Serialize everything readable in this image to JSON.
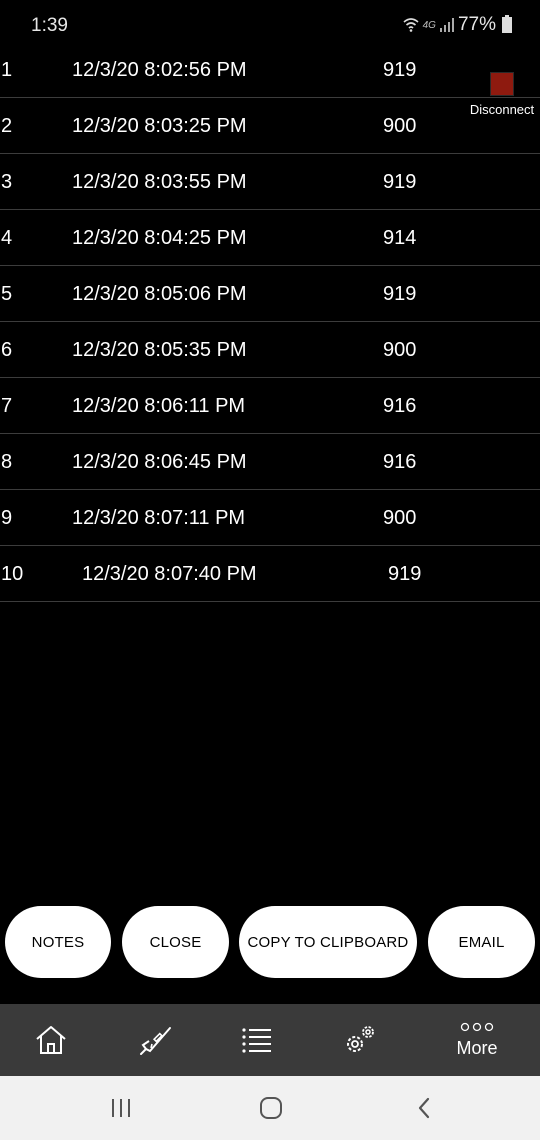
{
  "status_bar": {
    "time": "1:39",
    "network": "4G",
    "battery": "77%"
  },
  "readings": [
    {
      "index": "1",
      "timestamp": "12/3/20 8:02:56 PM",
      "value": "919"
    },
    {
      "index": "2",
      "timestamp": "12/3/20 8:03:25 PM",
      "value": "900"
    },
    {
      "index": "3",
      "timestamp": "12/3/20 8:03:55 PM",
      "value": "919"
    },
    {
      "index": "4",
      "timestamp": "12/3/20 8:04:25 PM",
      "value": "914"
    },
    {
      "index": "5",
      "timestamp": "12/3/20 8:05:06 PM",
      "value": "919"
    },
    {
      "index": "6",
      "timestamp": "12/3/20 8:05:35 PM",
      "value": "900"
    },
    {
      "index": "7",
      "timestamp": "12/3/20 8:06:11 PM",
      "value": "916"
    },
    {
      "index": "8",
      "timestamp": "12/3/20 8:06:45 PM",
      "value": "916"
    },
    {
      "index": "9",
      "timestamp": "12/3/20 8:07:11 PM",
      "value": "900"
    },
    {
      "index": "10",
      "timestamp": "12/3/20 8:07:40 PM",
      "value": "919"
    }
  ],
  "disconnect": {
    "label": "Disconnect",
    "color": "#8e1a0f"
  },
  "actions": {
    "notes": "NOTES",
    "close": "CLOSE",
    "copy": "COPY TO CLIPBOARD",
    "email": "EMAIL"
  },
  "tabbar": {
    "tabs": [
      {
        "icon": "home-icon"
      },
      {
        "icon": "rifle-icon"
      },
      {
        "icon": "list-icon"
      },
      {
        "icon": "settings-icon"
      },
      {
        "icon": "more-icon",
        "label": "More"
      }
    ]
  },
  "navbar": {
    "icons": [
      "recent-apps-icon",
      "home-circle-icon",
      "back-icon"
    ]
  }
}
